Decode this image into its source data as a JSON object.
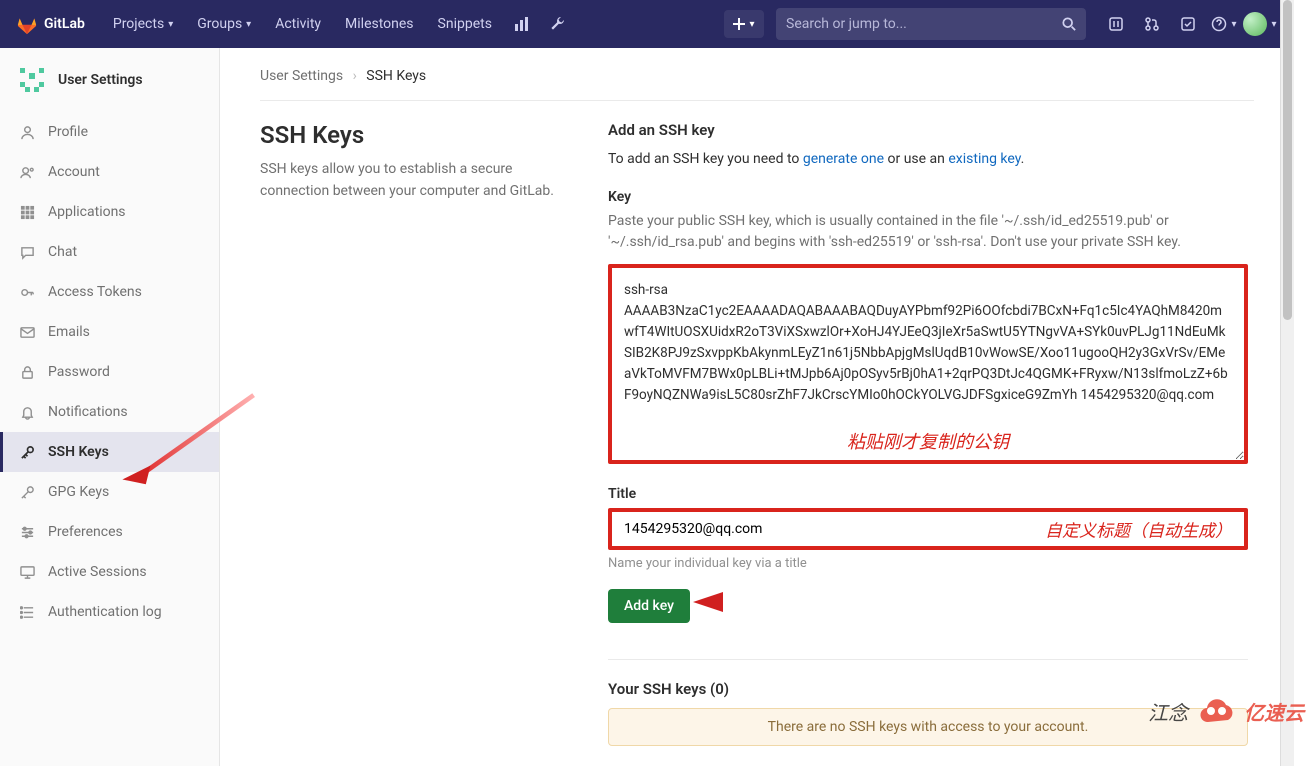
{
  "brand": "GitLab",
  "nav": {
    "projects": "Projects",
    "groups": "Groups",
    "activity": "Activity",
    "milestones": "Milestones",
    "snippets": "Snippets"
  },
  "search": {
    "placeholder": "Search or jump to..."
  },
  "sidebar": {
    "title": "User Settings",
    "items": {
      "profile": "Profile",
      "account": "Account",
      "applications": "Applications",
      "chat": "Chat",
      "access_tokens": "Access Tokens",
      "emails": "Emails",
      "password": "Password",
      "notifications": "Notifications",
      "ssh_keys": "SSH Keys",
      "gpg_keys": "GPG Keys",
      "preferences": "Preferences",
      "active_sessions": "Active Sessions",
      "auth_log": "Authentication log"
    }
  },
  "breadcrumb": {
    "root": "User Settings",
    "current": "SSH Keys"
  },
  "page": {
    "heading": "SSH Keys",
    "description": "SSH keys allow you to establish a secure connection between your computer and GitLab."
  },
  "form": {
    "add_heading": "Add an SSH key",
    "add_text_pre": "To add an SSH key you need to ",
    "generate_link": "generate one",
    "add_text_mid": " or use an ",
    "existing_link": "existing key",
    "key_label": "Key",
    "key_hint": "Paste your public SSH key, which is usually contained in the file '~/.ssh/id_ed25519.pub' or '~/.ssh/id_rsa.pub' and begins with 'ssh-ed25519' or 'ssh-rsa'. Don't use your private SSH key.",
    "key_value": "ssh-rsa AAAAB3NzaC1yc2EAAAADAQABAAABAQDuyAYPbmf92Pi6OOfcbdi7BCxN+Fq1c5Ic4YAQhM8420mwfT4WItUOSXUidxR2oT3ViXSxwzlOr+XoHJ4YJEeQ3jIeXr5aSwtU5YTNgvVA+SYk0uvPLJg11NdEuMkSIB2K8PJ9zSxvppKbAkynmLEyZ1n61j5NbbApjgMslUqdB10vWowSE/Xoo11ugooQH2y3GxVrSv/EMeaVkToMVFM7BWx0pLBLi+tMJpb6Aj0pOSyv5rBj0hA1+2qrPQ3DtJc4QGMK+FRyxw/N13slfmoLzZ+6bF9oyNQZNWa9isL5C80srZhF7JkCrscYMIo0hOCkYOLVGJDFSgxiceG9ZmYh 1454295320@qq.com",
    "title_label": "Title",
    "title_value": "1454295320@qq.com",
    "title_hint": "Name your individual key via a title",
    "add_button": "Add key"
  },
  "annotations": {
    "paste_key": "粘贴刚才复制的公钥",
    "custom_title": "自定义标题（自动生成）"
  },
  "your_keys": {
    "heading": "Your SSH keys (0)",
    "empty": "There are no SSH keys with access to your account."
  },
  "watermark": {
    "text1": "江念",
    "text2": "亿速云"
  }
}
